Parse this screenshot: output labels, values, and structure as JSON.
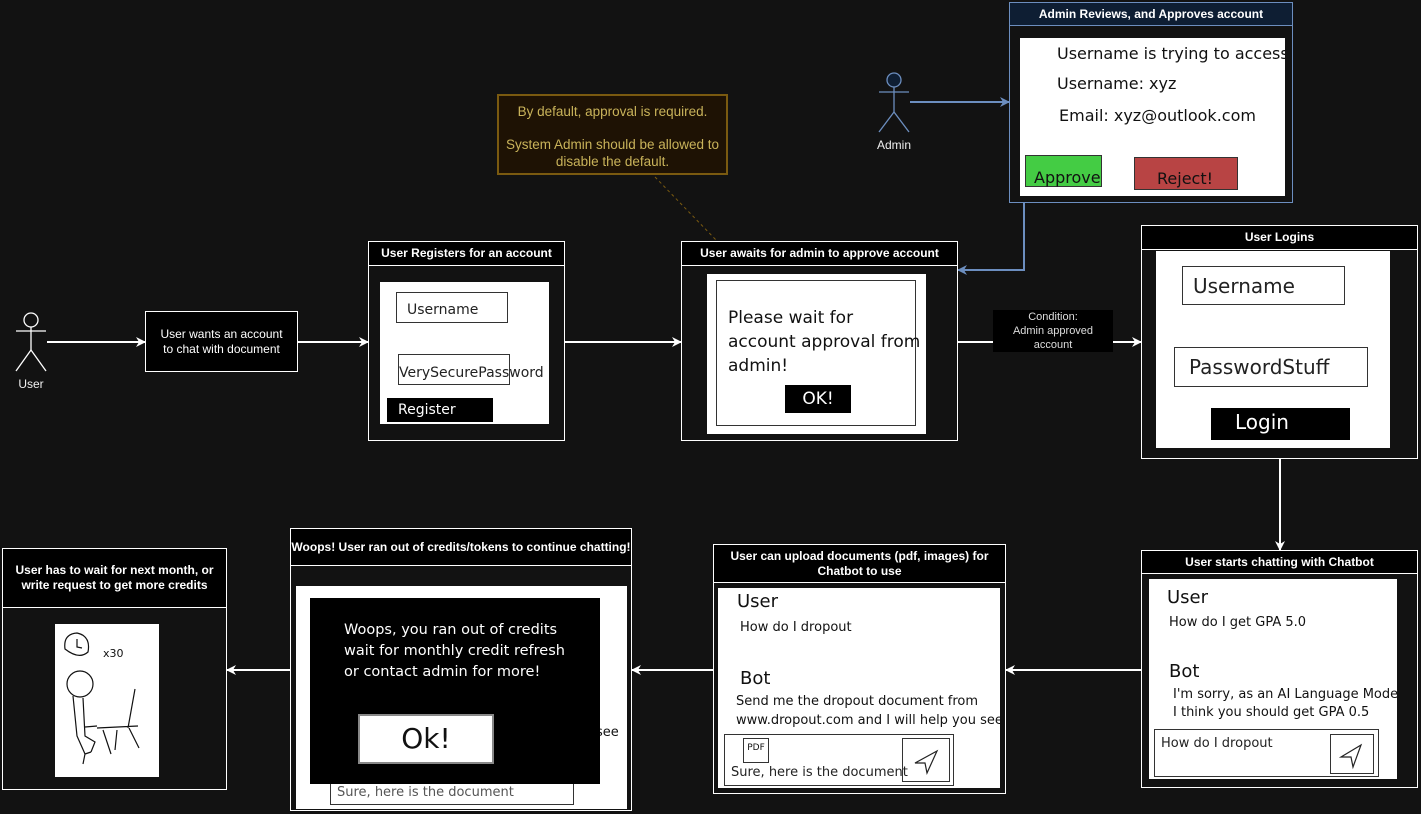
{
  "actors": {
    "user": "User",
    "admin": "Admin"
  },
  "note": {
    "line1": "By default, approval is required.",
    "line2": "System Admin should be allowed to disable the default."
  },
  "condition_label": {
    "line1": "Condition:",
    "line2": "Admin approved account"
  },
  "steps": {
    "want_account": "User wants an account to chat with document",
    "register": {
      "title": "User Registers for an account",
      "username": "Username",
      "password": "VerySecurePassword",
      "button": "Register"
    },
    "await": {
      "title": "User awaits for admin to approve account",
      "message": "Please wait for account approval from admin!",
      "button": "OK!"
    },
    "admin_review": {
      "title": "Admin Reviews, and Approves account",
      "line1": "Username is trying to access!",
      "line2": "Username: xyz",
      "line3": "Email: xyz@outlook.com",
      "approve": "Approve",
      "reject": "Reject!",
      "approve_color": "#44cc44",
      "reject_color": "#b84444"
    },
    "login": {
      "title": "User Logins",
      "username": "Username",
      "password": "PasswordStuff",
      "button": "Login"
    },
    "chat": {
      "title": "User starts chatting with Chatbot",
      "user_label": "User",
      "user_msg": "How do I get GPA 5.0",
      "bot_label": "Bot",
      "bot_msg1": "I'm sorry, as an AI Language Model",
      "bot_msg2": "I think you should get GPA 0.5",
      "input": "How do I dropout"
    },
    "upload": {
      "title": "User can upload documents (pdf, images) for Chatbot to use",
      "user_label": "User",
      "user_msg": "How do I dropout",
      "bot_label": "Bot",
      "bot_msg1": "Send me the dropout document from",
      "bot_msg2": "www.dropout.com and I will help you see",
      "attachment": "PDF",
      "input": "Sure, here is the document"
    },
    "out_of_credits": {
      "title": "Woops! User ran out of credits/tokens to continue chatting!",
      "msg1": "Woops, you ran out of credits",
      "msg2": "wait for monthly credit refresh",
      "msg3": "or contact admin for more!",
      "button": "Ok!",
      "bg_peek": "see",
      "bg_input": "Sure, here is the document"
    },
    "wait": {
      "title": "User has to wait for next month, or write request to get more credits",
      "sketch_label": "x30"
    }
  }
}
